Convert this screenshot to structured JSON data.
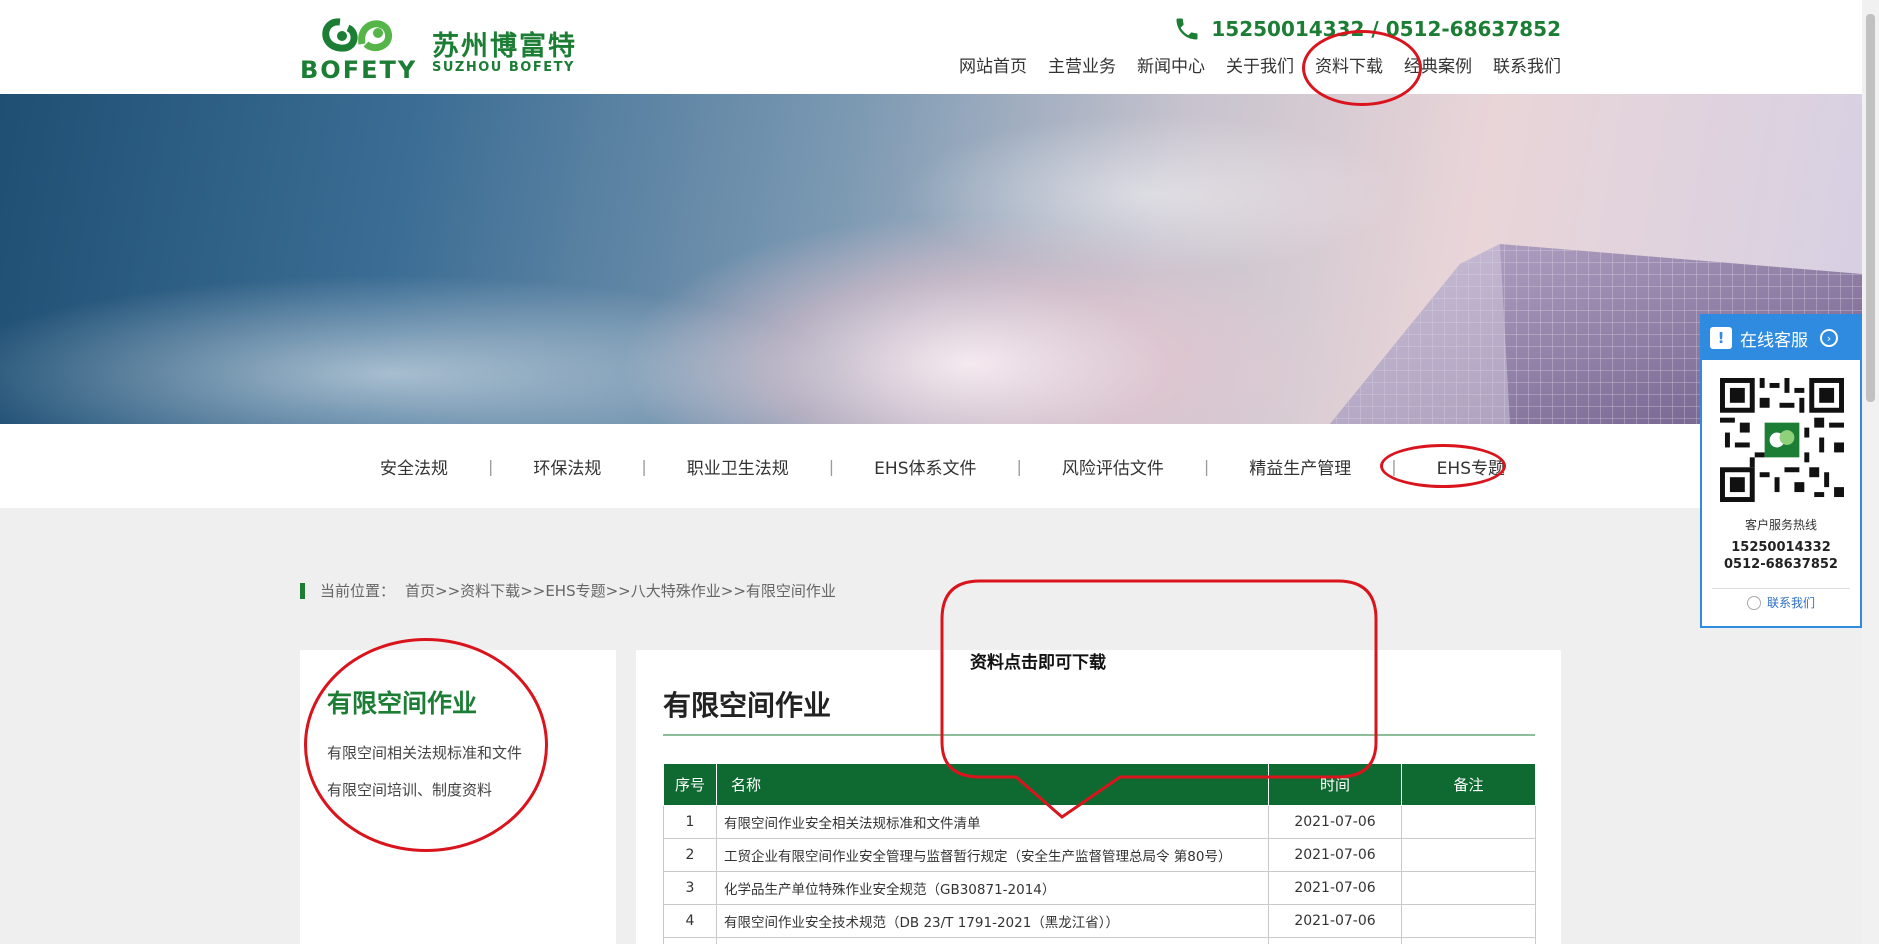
{
  "header": {
    "logo_cn": "苏州博富特",
    "logo_en": "SUZHOU BOFETY",
    "logo_word": "BOFETY",
    "phone": "15250014332 / 0512-68637852",
    "nav": [
      "网站首页",
      "主营业务",
      "新闻中心",
      "关于我们",
      "资料下载",
      "经典案例",
      "联系我们"
    ]
  },
  "categories": [
    "安全法规",
    "环保法规",
    "职业卫生法规",
    "EHS体系文件",
    "风险评估文件",
    "精益生产管理",
    "EHS专题"
  ],
  "breadcrumb": {
    "label": "当前位置：",
    "items": [
      "首页",
      "资料下载",
      "EHS专题",
      "八大特殊作业",
      "有限空间作业"
    ],
    "sep": ">>"
  },
  "sidebar": {
    "title": "有限空间作业",
    "items": [
      "有限空间相关法规标准和文件",
      "有限空间培训、制度资料"
    ]
  },
  "main": {
    "title": "有限空间作业",
    "annotation": "资料点击即可下载",
    "table": {
      "headers": [
        "序号",
        "名称",
        "时间",
        "备注"
      ],
      "rows": [
        [
          "1",
          "有限空间作业安全相关法规标准和文件清单",
          "2021-07-06",
          ""
        ],
        [
          "2",
          "工贸企业有限空间作业安全管理与监督暂行规定（安全生产监督管理总局令 第80号）",
          "2021-07-06",
          ""
        ],
        [
          "3",
          "化学品生产单位特殊作业安全规范（GB30871-2014）",
          "2021-07-06",
          ""
        ],
        [
          "4",
          "有限空间作业安全技术规范（DB 23/T 1791-2021（黑龙江省））",
          "2021-07-06",
          ""
        ]
      ]
    }
  },
  "service": {
    "title": "在线客服",
    "hotline_label": "客户服务热线",
    "phone1": "15250014332",
    "phone2": "0512-68637852",
    "contact": "联系我们"
  },
  "colors": {
    "brand_green": "#1c7d35",
    "table_header": "#0f6a31",
    "annotation_red": "#d9141d",
    "service_blue": "#2f8be0"
  }
}
